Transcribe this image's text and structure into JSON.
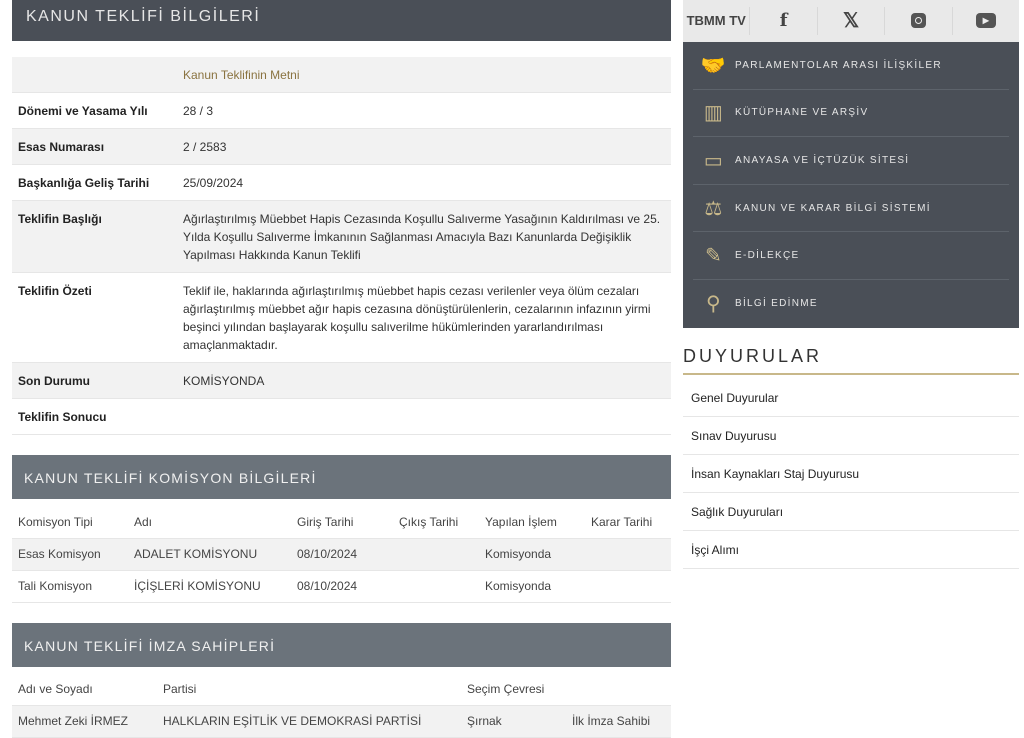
{
  "info": {
    "title": "KANUN TEKLİFİ BİLGİLERİ",
    "link": "Kanun Teklifinin Metni",
    "rows": [
      {
        "label": "Dönemi ve Yasama Yılı",
        "value": "28 / 3"
      },
      {
        "label": "Esas Numarası",
        "value": "2 / 2583"
      },
      {
        "label": "Başkanlığa Geliş Tarihi",
        "value": "25/09/2024"
      },
      {
        "label": "Teklifin Başlığı",
        "value": "Ağırlaştırılmış Müebbet Hapis Cezasında Koşullu Salıverme Yasağının Kaldırılması ve 25. Yılda Koşullu Salıverme İmkanının Sağlanması Amacıyla Bazı Kanunlarda Değişiklik Yapılması Hakkında Kanun Teklifi"
      },
      {
        "label": "Teklifin Özeti",
        "value": "Teklif ile, haklarında ağırlaştırılmış müebbet hapis cezası verilenler veya ölüm cezaları ağırlaştırılmış müebbet ağır hapis cezasına dönüştürülenlerin, cezalarının infazının yirmi beşinci yılından başlayarak koşullu salıverilme hükümlerinden yararlandırılması amaçlanmaktadır."
      },
      {
        "label": "Son Durumu",
        "value": "KOMİSYONDA"
      },
      {
        "label": "Teklifin Sonucu",
        "value": ""
      }
    ]
  },
  "commission": {
    "title": "KANUN TEKLİFİ KOMİSYON BİLGİLERİ",
    "headers": [
      "Komisyon Tipi",
      "Adı",
      "Giriş Tarihi",
      "Çıkış Tarihi",
      "Yapılan İşlem",
      "Karar Tarihi"
    ],
    "rows": [
      [
        "Esas Komisyon",
        "ADALET KOMİSYONU",
        "08/10/2024",
        "",
        "Komisyonda",
        ""
      ],
      [
        "Tali Komisyon",
        "İÇİŞLERİ KOMİSYONU",
        "08/10/2024",
        "",
        "Komisyonda",
        ""
      ]
    ]
  },
  "signers": {
    "title": "KANUN TEKLİFİ İMZA SAHİPLERİ",
    "headers": [
      "Adı ve Soyadı",
      "Partisi",
      "Seçim Çevresi",
      ""
    ],
    "rows": [
      [
        "Mehmet Zeki İRMEZ",
        "HALKLARIN EŞİTLİK VE DEMOKRASİ PARTİSİ",
        "Şırnak",
        "İlk İmza Sahibi"
      ]
    ]
  },
  "social": {
    "tv": "TBMM TV",
    "icons": [
      "facebook-icon",
      "x-icon",
      "instagram-icon",
      "youtube-icon"
    ]
  },
  "menu": [
    {
      "label": "PARLAMENTOLAR ARASI İLİŞKİLER",
      "icon": "handshake-icon"
    },
    {
      "label": "KÜTÜPHANE VE ARŞİV",
      "icon": "books-icon"
    },
    {
      "label": "ANAYASA VE İÇTÜZÜK SİTESİ",
      "icon": "browser-icon"
    },
    {
      "label": "KANUN VE KARAR BİLGİ SİSTEMİ",
      "icon": "scales-icon"
    },
    {
      "label": "E-DİLEKÇE",
      "icon": "quill-icon"
    },
    {
      "label": "BİLGİ EDİNME",
      "icon": "search-icon"
    }
  ],
  "announcements": {
    "title": "DUYURULAR",
    "items": [
      "Genel Duyurular",
      "Sınav Duyurusu",
      "İnsan Kaynakları Staj Duyurusu",
      "Sağlık Duyuruları",
      "İşçi Alımı"
    ]
  },
  "colors": {
    "header": "#4a4f57",
    "subheader": "#6b737b",
    "accent": "#8a7340"
  }
}
